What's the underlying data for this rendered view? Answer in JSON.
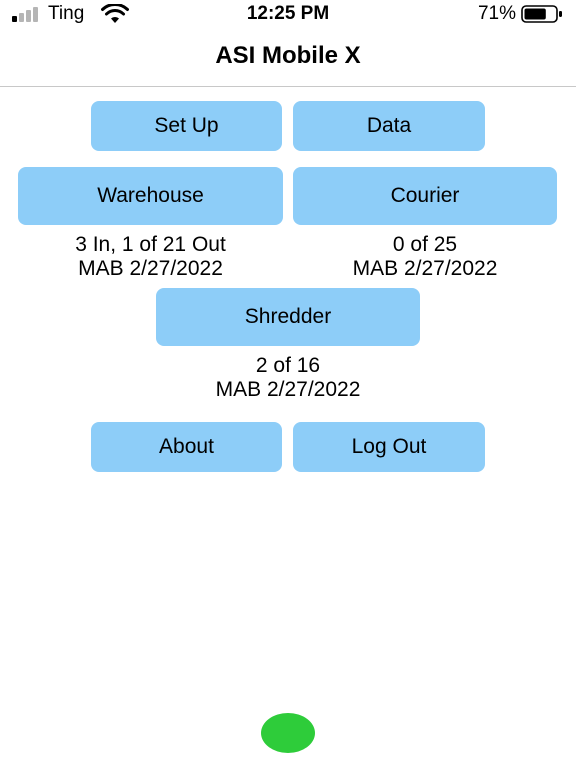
{
  "status_bar": {
    "carrier": "Ting",
    "time": "12:25 PM",
    "battery_percent": "71%",
    "battery_level": 0.71,
    "signal_bars_active": 1,
    "signal_bars_total": 4,
    "icons": [
      "signal-icon",
      "wifi-icon",
      "battery-icon"
    ]
  },
  "nav": {
    "title": "ASI Mobile X"
  },
  "buttons": {
    "setup": "Set Up",
    "data": "Data",
    "warehouse": "Warehouse",
    "courier": "Courier",
    "shredder": "Shredder",
    "about": "About",
    "logout": "Log Out"
  },
  "warehouse_info": {
    "count": "3 In, 1 of 21 Out",
    "user_date": "MAB 2/27/2022"
  },
  "courier_info": {
    "count": "0 of 25",
    "user_date": "MAB 2/27/2022"
  },
  "shredder_info": {
    "count": "2 of 16",
    "user_date": "MAB 2/27/2022"
  },
  "colors": {
    "button_bg": "#8dcdf8",
    "status_dot": "#2ecc3a",
    "text": "#000000",
    "divider": "#c8c8c8"
  }
}
